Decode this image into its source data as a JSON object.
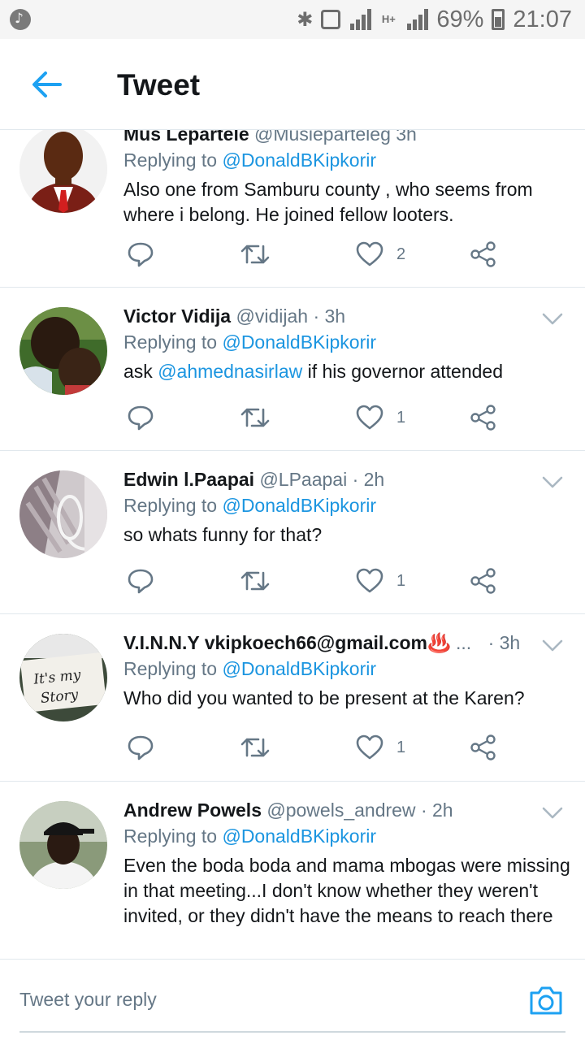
{
  "status_bar": {
    "battery": "69%",
    "time": "21:07",
    "network": "H+"
  },
  "header": {
    "title": "Tweet",
    "back_icon": "arrow-left-icon",
    "accent": "#1da1f2"
  },
  "tweets": [
    {
      "name": "Mus Lepartele",
      "handle": "@Musieparteleg",
      "time": "3h",
      "replying_prefix": "Replying to",
      "replying_to": "@DonaldBKipkorir",
      "text": "Also one from Samburu county , who seems from where i belong. He joined fellow looters.",
      "likes": "2"
    },
    {
      "name": "Victor Vidija",
      "handle": "@vidijah",
      "time": "· 3h",
      "replying_prefix": "Replying to",
      "replying_to": "@DonaldBKipkorir",
      "text_prefix": "ask ",
      "text_mention": "@ahmednasirlaw",
      "text_suffix": " if his governor attended",
      "likes": "1"
    },
    {
      "name": "Edwin l.Paapai",
      "handle": "@LPaapai",
      "time": "· 2h",
      "replying_prefix": "Replying to",
      "replying_to": "@DonaldBKipkorir",
      "text": "so whats funny for that?",
      "likes": "1"
    },
    {
      "name": "V.I.N.N.Y vkipkoech66@gmail.com♨️",
      "handle": "...",
      "time": "· 3h",
      "replying_prefix": "Replying to",
      "replying_to": "@DonaldBKipkorir",
      "text": "Who did you wanted to be present at the Karen?",
      "likes": "1",
      "avatar_text_1": "It's my",
      "avatar_text_2": "Story"
    },
    {
      "name": "Andrew Powels",
      "handle": "@powels_andrew",
      "time": "· 2h",
      "replying_prefix": "Replying to",
      "replying_to": "@DonaldBKipkorir",
      "text": "Even the boda boda and mama mbogas were missing in that meeting...I don't know whether they weren't invited, or they didn't have the means to reach there"
    }
  ],
  "reply_bar": {
    "placeholder": "Tweet your reply",
    "camera_icon": "camera-icon"
  }
}
